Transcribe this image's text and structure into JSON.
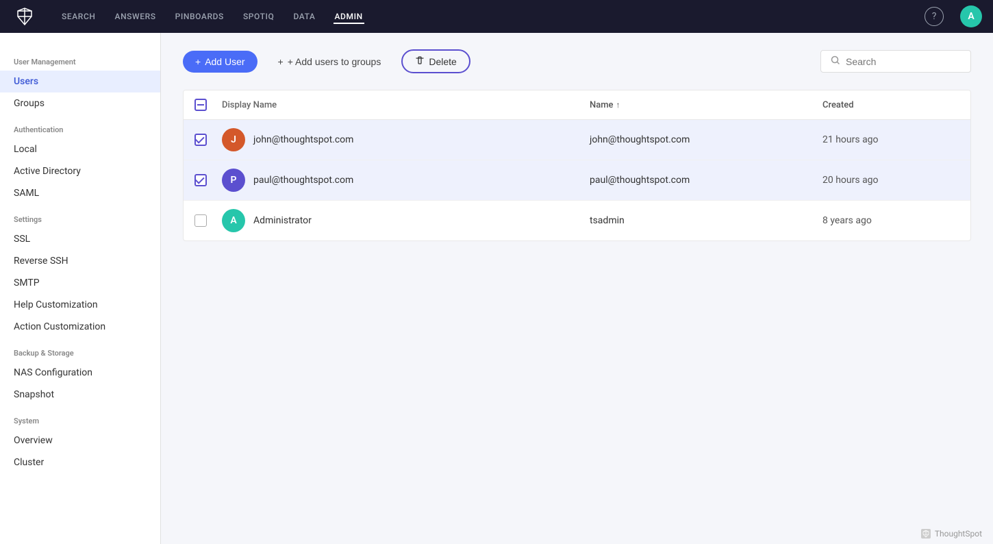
{
  "topnav": {
    "logo_text": "TS",
    "items": [
      {
        "label": "SEARCH",
        "active": false
      },
      {
        "label": "ANSWERS",
        "active": false
      },
      {
        "label": "PINBOARDS",
        "active": false
      },
      {
        "label": "SPOTIQ",
        "active": false
      },
      {
        "label": "DATA",
        "active": false
      },
      {
        "label": "ADMIN",
        "active": true
      }
    ],
    "help_label": "?",
    "avatar_label": "A"
  },
  "sidebar": {
    "sections": [
      {
        "label": "User Management",
        "items": [
          {
            "id": "users",
            "label": "Users",
            "active": true
          },
          {
            "id": "groups",
            "label": "Groups",
            "active": false
          }
        ]
      },
      {
        "label": "Authentication",
        "items": [
          {
            "id": "local",
            "label": "Local",
            "active": false
          },
          {
            "id": "active-directory",
            "label": "Active Directory",
            "active": false
          },
          {
            "id": "saml",
            "label": "SAML",
            "active": false
          }
        ]
      },
      {
        "label": "Settings",
        "items": [
          {
            "id": "ssl",
            "label": "SSL",
            "active": false
          },
          {
            "id": "reverse-ssh",
            "label": "Reverse SSH",
            "active": false
          },
          {
            "id": "smtp",
            "label": "SMTP",
            "active": false
          },
          {
            "id": "help-customization",
            "label": "Help Customization",
            "active": false
          },
          {
            "id": "action-customization",
            "label": "Action Customization",
            "active": false
          }
        ]
      },
      {
        "label": "Backup & Storage",
        "items": [
          {
            "id": "nas-configuration",
            "label": "NAS Configuration",
            "active": false
          },
          {
            "id": "snapshot",
            "label": "Snapshot",
            "active": false
          }
        ]
      },
      {
        "label": "System",
        "items": [
          {
            "id": "overview",
            "label": "Overview",
            "active": false
          },
          {
            "id": "cluster",
            "label": "Cluster",
            "active": false
          }
        ]
      }
    ]
  },
  "toolbar": {
    "add_user_label": "+ Add User",
    "add_to_groups_label": "+ Add users to groups",
    "delete_label": "Delete",
    "search_placeholder": "Search"
  },
  "table": {
    "columns": {
      "display_name": "Display Name",
      "name": "Name",
      "name_sort": "↑",
      "created": "Created"
    },
    "rows": [
      {
        "id": "row-1",
        "selected": true,
        "avatar_letter": "J",
        "avatar_color": "#d4582a",
        "display_name": "john@thoughtspot.com",
        "name": "john@thoughtspot.com",
        "created": "21 hours ago"
      },
      {
        "id": "row-2",
        "selected": true,
        "avatar_letter": "P",
        "avatar_color": "#5b4fcf",
        "display_name": "paul@thoughtspot.com",
        "name": "paul@thoughtspot.com",
        "created": "20 hours ago"
      },
      {
        "id": "row-3",
        "selected": false,
        "avatar_letter": "A",
        "avatar_color": "#26c6ab",
        "display_name": "Administrator",
        "name": "tsadmin",
        "created": "8 years ago"
      }
    ]
  },
  "footer": {
    "brand": "ThoughtSpot"
  }
}
